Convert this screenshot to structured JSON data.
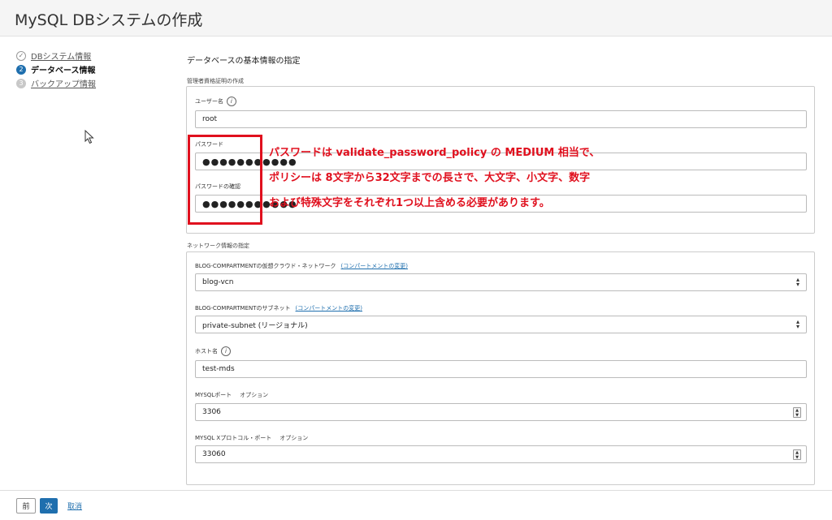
{
  "header": {
    "title": "MySQL DBシステムの作成"
  },
  "steps": [
    {
      "num": "✓",
      "label": "DBシステム情報",
      "state": "done"
    },
    {
      "num": "2",
      "label": "データベース情報",
      "state": "current"
    },
    {
      "num": "3",
      "label": "バックアップ情報",
      "state": "pending"
    }
  ],
  "main": {
    "section_title": "データベースの基本情報の指定",
    "admin_group_label": "管理者資格証明の作成",
    "username": {
      "label": "ユーザー名",
      "value": "root"
    },
    "password": {
      "label": "パスワード",
      "value": "●●●●●●●●●●●"
    },
    "password_confirm": {
      "label": "パスワードの確認",
      "value": "●●●●●●●●●●●"
    },
    "network_group_label": "ネットワーク情報の指定",
    "vcn": {
      "label": "BLOG-COMPARTMENTの仮想クラウド・ネットワーク",
      "link": "(コンパートメントの変更)",
      "value": "blog-vcn"
    },
    "subnet": {
      "label": "BLOG-COMPARTMENTのサブネット",
      "link": "(コンパートメントの変更)",
      "value": "private-subnet (リージョナル)"
    },
    "hostname": {
      "label": "ホスト名",
      "value": "test-mds"
    },
    "mysql_port": {
      "label": "MYSQLポート",
      "optional": "オプション",
      "value": "3306"
    },
    "mysqlx_port": {
      "label": "MYSQL Xプロトコル・ポート",
      "optional": "オプション",
      "value": "33060"
    }
  },
  "annotation": {
    "line1": "パスワードは validate_password_policy の MEDIUM 相当で、",
    "line2": "ポリシーは 8文字から32文字までの長さで、大文字、小文字、数字",
    "line3": "および特殊文字をそれぞれ1つ以上含める必要があります。",
    "color": "#e0101e"
  },
  "footer": {
    "prev": "前",
    "next": "次",
    "cancel": "取消"
  }
}
